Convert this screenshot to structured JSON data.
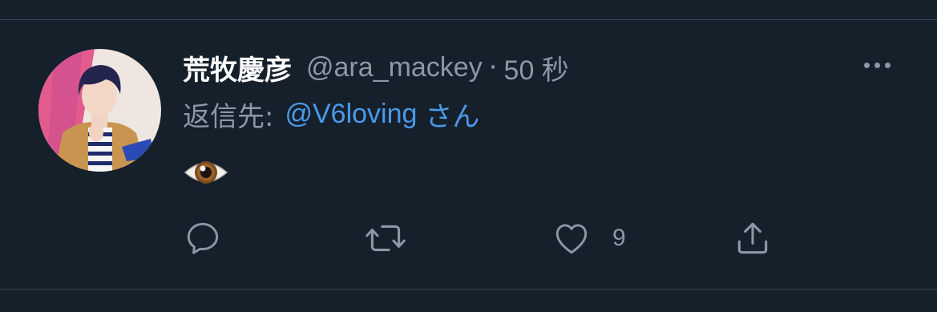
{
  "tweet": {
    "display_name": "荒牧慶彦",
    "handle": "@ara_mackey",
    "separator": "·",
    "time": "50 秒",
    "reply_prefix": "返信先:",
    "reply_to": "@V6loving",
    "reply_suffix": "さん",
    "body_emoji": "eye-emoji"
  },
  "actions": {
    "reply_icon": "reply-icon",
    "retweet_icon": "retweet-icon",
    "like_icon": "heart-icon",
    "like_count": "9",
    "share_icon": "share-icon"
  },
  "colors": {
    "background": "#15202b",
    "secondary_text": "#8b98a5",
    "link": "#4a99e9",
    "divider": "#38444d"
  }
}
